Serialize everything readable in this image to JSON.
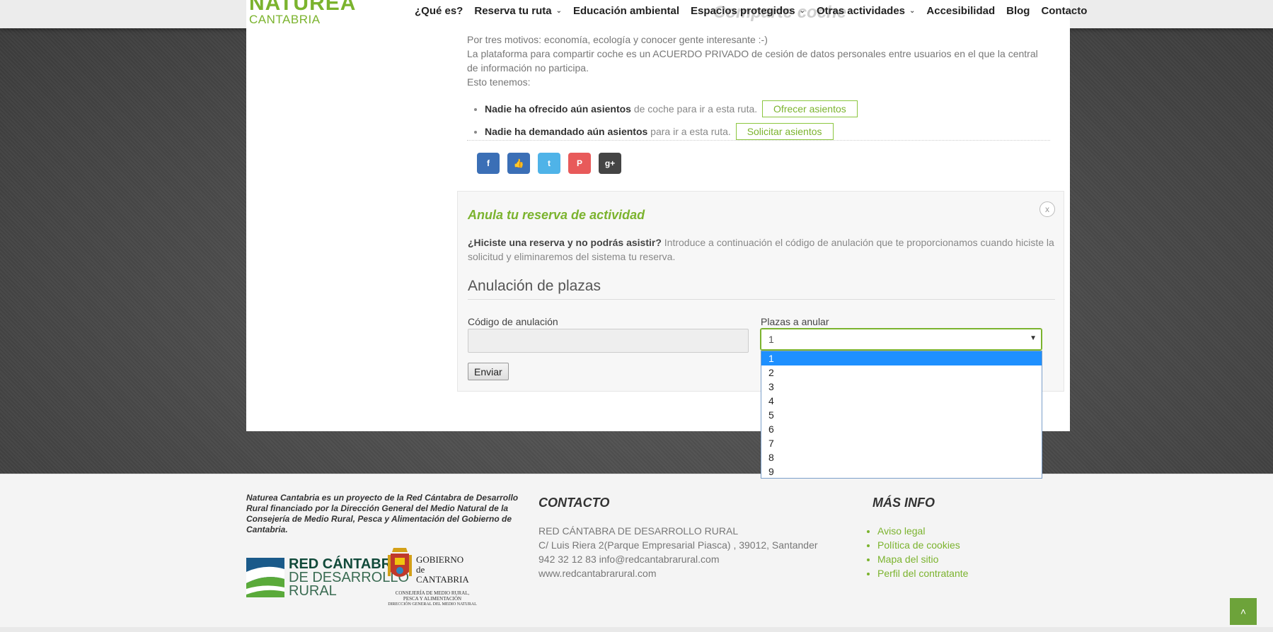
{
  "header": {
    "logo_main": "NATUREA",
    "logo_sub": "CANTABRIA",
    "behind_title": "Comparte coche",
    "nav": [
      {
        "label": "¿Qué es?",
        "caret": false
      },
      {
        "label": "Reserva tu ruta",
        "caret": true
      },
      {
        "label": "Educación ambiental",
        "caret": false
      },
      {
        "label": "Espacios protegidos",
        "caret": true
      },
      {
        "label": "Otras actividades",
        "caret": true
      },
      {
        "label": "Accesibilidad",
        "caret": false
      },
      {
        "label": "Blog",
        "caret": false
      },
      {
        "label": "Contacto",
        "caret": false
      }
    ]
  },
  "carpool": {
    "line1": "Por tres motivos: economía, ecología y conocer gente interesante :-)",
    "line2": "La plataforma para compartir coche es un ACUERDO PRIVADO de cesión de datos personales entre usuarios en el que la central de información no participa.",
    "line3": "Esto tenemos:",
    "offer_bold": "Nadie ha ofrecido aún asientos",
    "offer_rest": "de coche para ir a esta ruta.",
    "offer_button": "Ofrecer asientos",
    "demand_bold": "Nadie ha demandado aún asientos",
    "demand_rest": "para ir a esta ruta.",
    "demand_button": "Solicitar asientos"
  },
  "social": [
    {
      "icon": "facebook-icon",
      "glyph": "f",
      "color": "#3b6fb6"
    },
    {
      "icon": "like-icon",
      "glyph": "👍",
      "color": "#3b6fb6"
    },
    {
      "icon": "twitter-icon",
      "glyph": "t",
      "color": "#4fb3e8"
    },
    {
      "icon": "pinterest-icon",
      "glyph": "P",
      "color": "#e85a5a"
    },
    {
      "icon": "google-plus-icon",
      "glyph": "g+",
      "color": "#444444"
    }
  ],
  "cancel": {
    "title": "Anula tu reserva de actividad",
    "close": "x",
    "desc_bold": "¿Hiciste una reserva y no podrás asistir?",
    "desc_rest": " Introduce a continuación el código de anulación que te proporcionamos cuando hiciste la solicitud y eliminaremos del sistema tu reserva.",
    "heading": "Anulación de plazas",
    "code_label": "Código de anulación",
    "code_value": "",
    "seats_label": "Plazas a anular",
    "seats_selected": "1",
    "seats_options": [
      "1",
      "2",
      "3",
      "4",
      "5",
      "6",
      "7",
      "8",
      "9"
    ],
    "submit": "Enviar"
  },
  "footer": {
    "about": "Naturea Cantabria es un proyecto de la Red Cántabra de Desarrollo Rural financiado por la Dirección General del Medio Natural de la Consejería de Medio Rural, Pesca y Alimentación del Gobierno de Cantabria.",
    "logo_red": [
      "RED CÁNTABRA",
      "DE DESARROLLO",
      "RURAL"
    ],
    "logo_gob": [
      "GOBIERNO",
      "de",
      "CANTABRIA"
    ],
    "logo_gob_small": [
      "CONSEJERÍA DE MEDIO RURAL,",
      "PESCA Y ALIMENTACIÓN",
      "DIRECCIÓN GENERAL DEL MEDIO NATURAL"
    ],
    "contact_title": "CONTACTO",
    "contact_lines": [
      "RED CÁNTABRA DE DESARROLLO RURAL",
      "C/ Luis Riera 2(Parque Empresarial Piasca) , 39012, Santander",
      "942 32 12 83 info@redcantabrarural.com",
      "www.redcantabrarural.com"
    ],
    "more_title": "MÁS INFO",
    "more_links": [
      "Aviso legal",
      "Política de cookies",
      "Mapa del sitio",
      "Perfil del contratante"
    ]
  },
  "to_top": "˄"
}
